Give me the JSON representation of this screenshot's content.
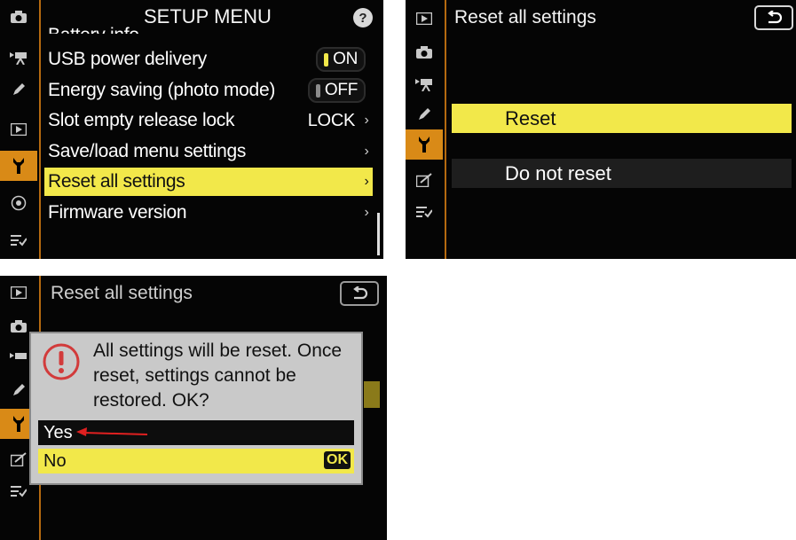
{
  "panel1": {
    "title": "SETUP MENU",
    "help_label": "?",
    "cut_item": "Battery info",
    "items": [
      {
        "label": "USB power delivery",
        "value": "ON",
        "kind": "toggle-on"
      },
      {
        "label": "Energy saving (photo mode)",
        "value": "OFF",
        "kind": "toggle-off"
      },
      {
        "label": "Slot empty release lock",
        "value": "LOCK",
        "kind": "value"
      },
      {
        "label": "Save/load menu settings",
        "value": "",
        "kind": "plain"
      },
      {
        "label": "Reset all settings",
        "value": "",
        "kind": "selected"
      },
      {
        "label": "Firmware version",
        "value": "",
        "kind": "plain"
      }
    ],
    "chevron": "›",
    "colors": {
      "highlight": "#f2e84a",
      "accent": "#d98a17"
    }
  },
  "panel2": {
    "title": "Reset all settings",
    "options": [
      "Reset",
      "Do not reset"
    ],
    "selected": "Reset"
  },
  "panel3": {
    "title": "Reset all settings",
    "dialog_message": "All settings will be reset. Once reset, settings cannot be restored. OK?",
    "options": [
      "Yes",
      "No"
    ],
    "selected": "No",
    "ok_badge": "OK"
  },
  "icons": [
    "camera-icon",
    "movie-icon",
    "pencil-icon",
    "playback-icon",
    "wrench-icon",
    "network-icon",
    "my-menu-icon",
    "retouch-icon",
    "warning-icon",
    "back-icon",
    "red-arrow"
  ]
}
